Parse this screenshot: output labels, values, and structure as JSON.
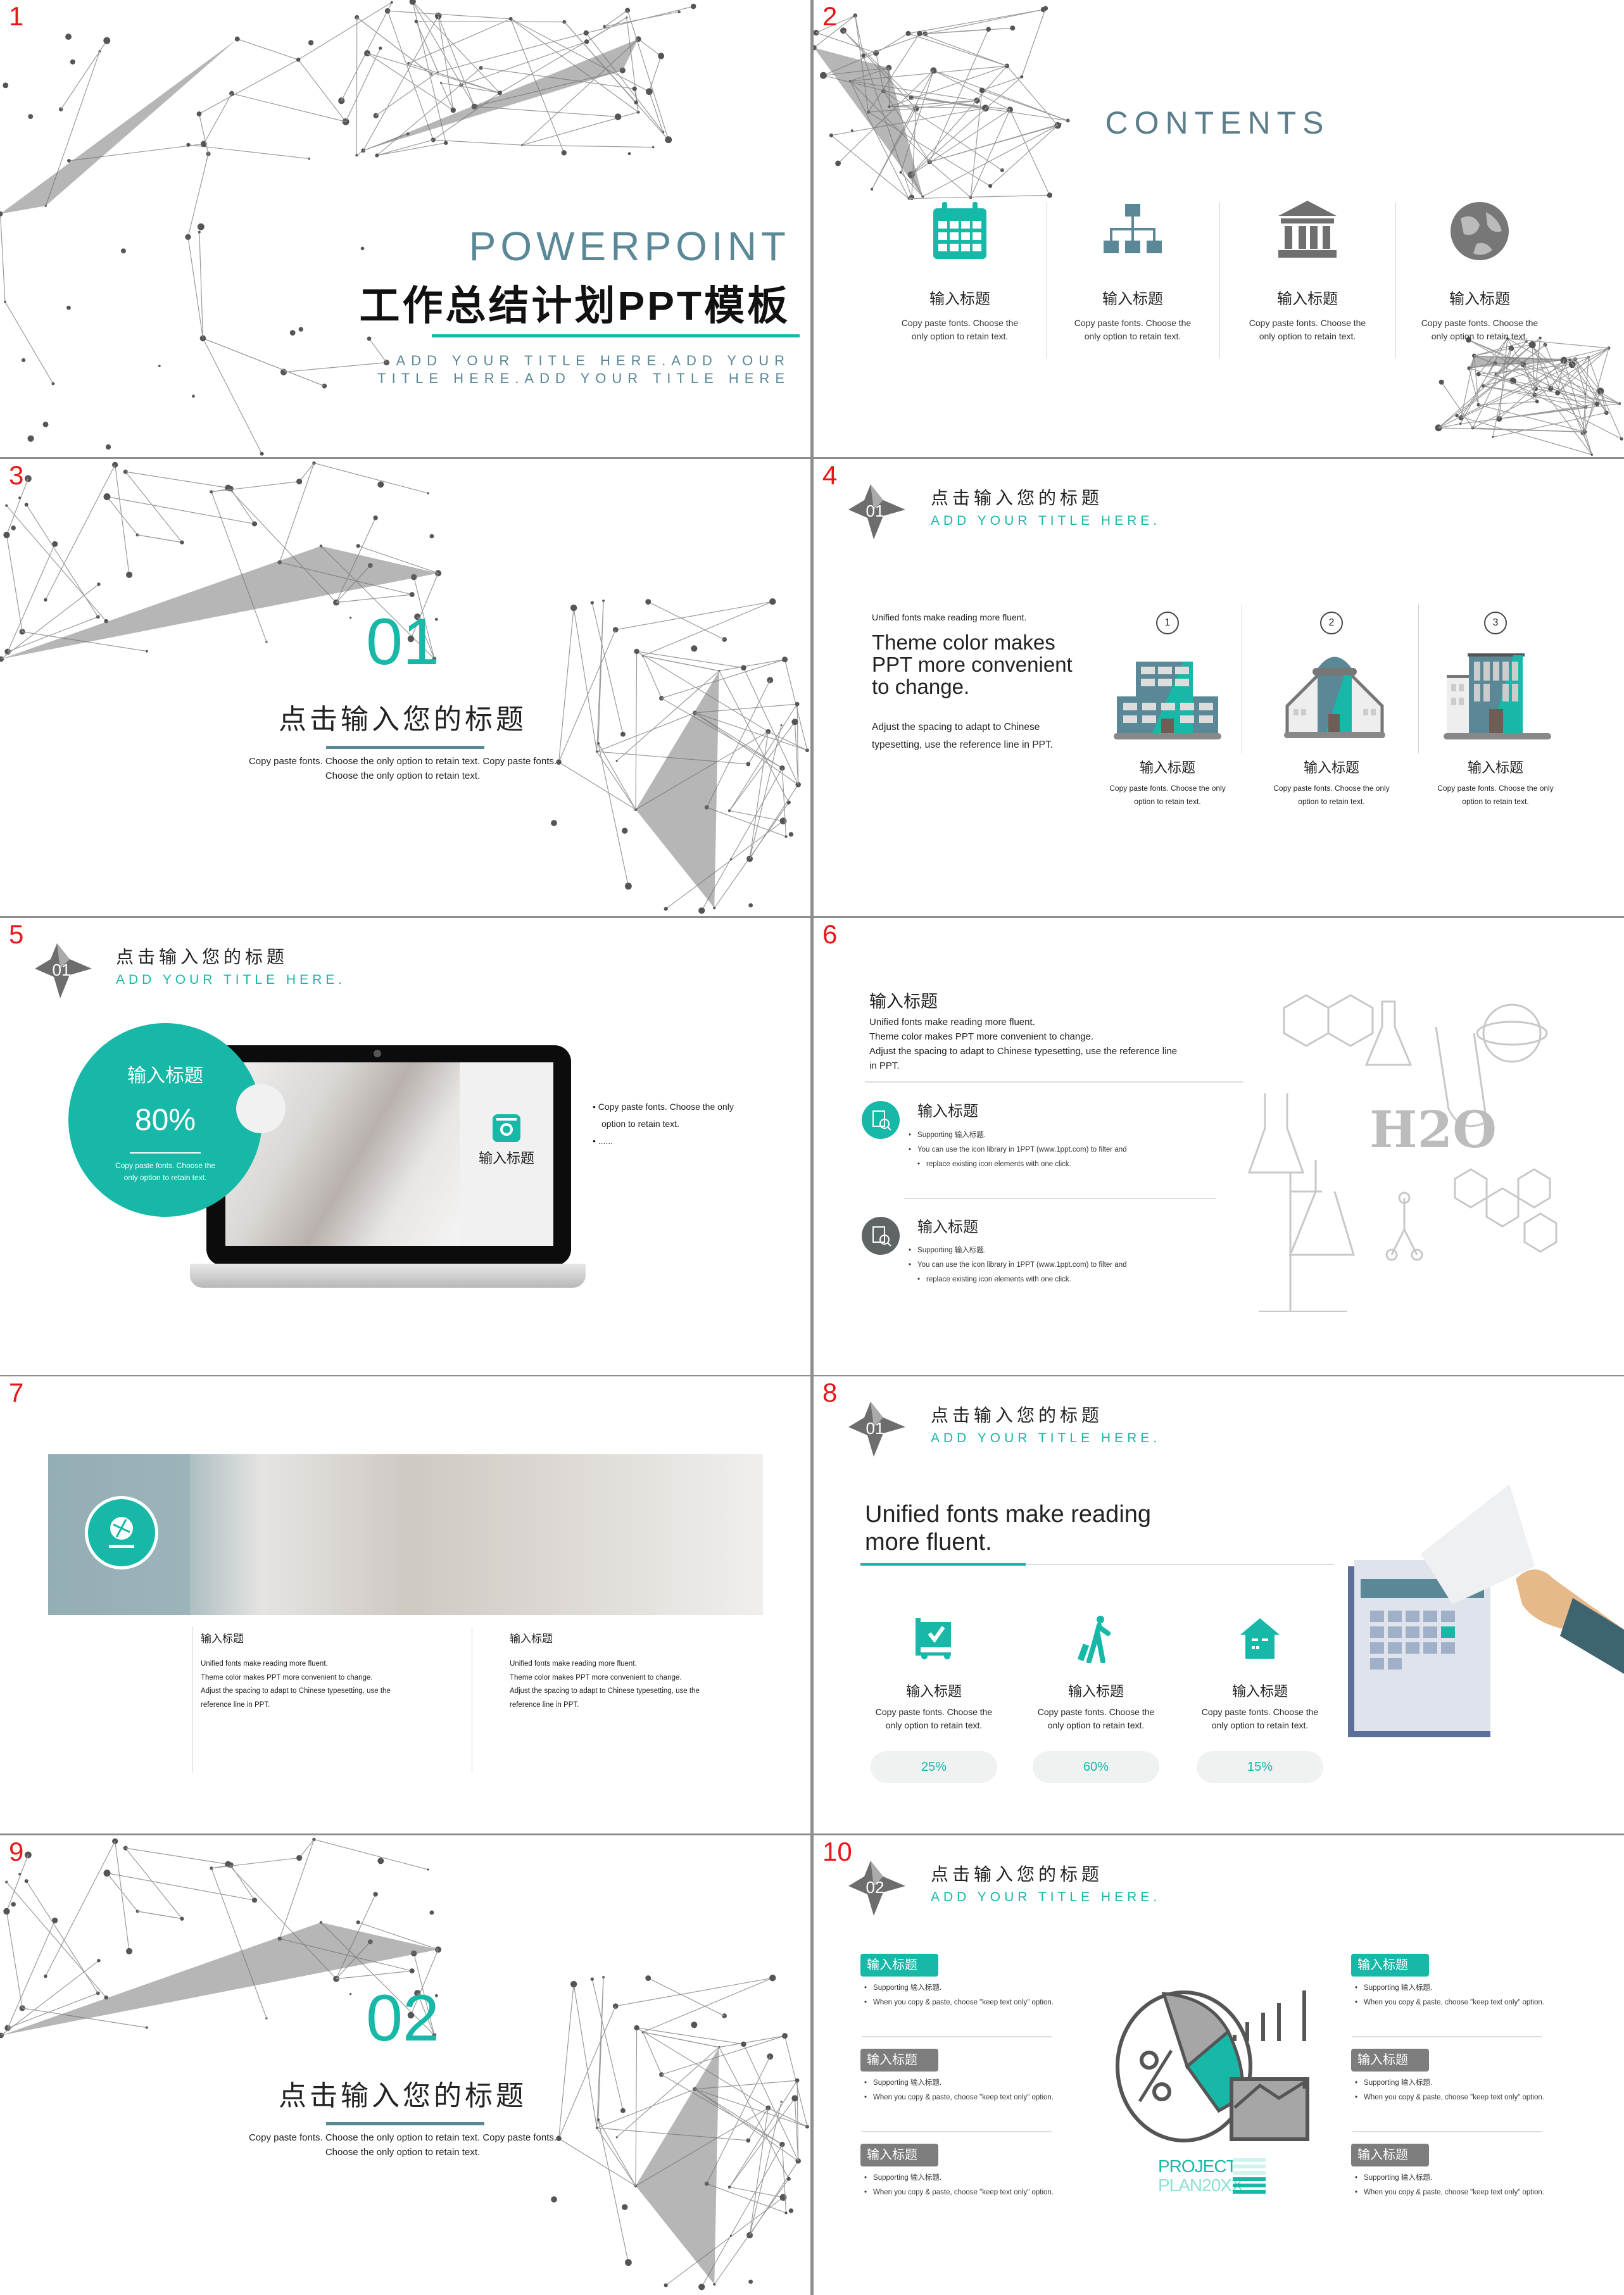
{
  "colors": {
    "accent": "#17b8a7",
    "secondary": "#5b8896",
    "gray": "#7a7a7a",
    "slide_number": "#e8161a"
  },
  "s1": {
    "number": "1",
    "brand": "POWERPOINT",
    "title": "工作总结计划PPT模板",
    "subtitle_line1": "ADD YOUR TITLE HERE.ADD YOUR",
    "subtitle_line2": "TITLE HERE.ADD YOUR TITLE HERE"
  },
  "s2": {
    "number": "2",
    "heading": "CONTENTS",
    "items": [
      {
        "icon": "calendar-icon",
        "label": "输入标题",
        "desc1": "Copy paste fonts. Choose the",
        "desc2": "only option to retain text."
      },
      {
        "icon": "org-chart-icon",
        "label": "输入标题",
        "desc1": "Copy paste fonts. Choose the",
        "desc2": "only option to retain text."
      },
      {
        "icon": "bank-icon",
        "label": "输入标题",
        "desc1": "Copy paste fonts. Choose the",
        "desc2": "only option to retain text."
      },
      {
        "icon": "globe-icon",
        "label": "输入标题",
        "desc1": "Copy paste fonts. Choose the",
        "desc2": "only option to retain text."
      }
    ]
  },
  "s3": {
    "number": "3",
    "section": "01",
    "title": "点击输入您的标题",
    "desc1": "Copy paste fonts. Choose the only option to retain text. Copy paste fonts.",
    "desc2": "Choose the only option to retain text."
  },
  "s4": {
    "number": "4",
    "badge": "01",
    "title": "点击输入您的标题",
    "subtitle": "ADD YOUR TITLE HERE.",
    "intro": "Unified fonts make reading more fluent.",
    "big1": "Theme color makes",
    "big2": "PPT more convenient",
    "big3": "to change.",
    "adjust1": "Adjust the spacing to adapt to Chinese",
    "adjust2": "typesetting, use the reference line in PPT.",
    "items": [
      {
        "step": "1",
        "label": "输入标题",
        "desc1": "Copy paste fonts. Choose the only",
        "desc2": "option to retain text."
      },
      {
        "step": "2",
        "label": "输入标题",
        "desc1": "Copy paste fonts. Choose the only",
        "desc2": "option to retain text."
      },
      {
        "step": "3",
        "label": "输入标题",
        "desc1": "Copy paste fonts. Choose the only",
        "desc2": "option to retain text."
      }
    ]
  },
  "s5": {
    "number": "5",
    "badge": "01",
    "title": "点击输入您的标题",
    "subtitle": "ADD YOUR TITLE HERE.",
    "circle_title": "输入标题",
    "percent": "80%",
    "percent_value": 80,
    "circle_desc1": "Copy paste fonts. Choose the",
    "circle_desc2": "only option to retain text.",
    "panel_label": "输入标题",
    "bullet1a": "Copy paste fonts. Choose the only",
    "bullet1b": "option to retain text.",
    "bullet2": "......"
  },
  "s6": {
    "number": "6",
    "heading": "输入标题",
    "lines": [
      "Unified fonts make reading more fluent.",
      "Theme color makes PPT more convenient to change.",
      "Adjust the spacing to adapt to Chinese typesetting, use the reference line",
      "in PPT."
    ],
    "items": [
      {
        "title": "输入标题",
        "b1": "Supporting 输入标题.",
        "b2": "You can use the icon library in 1PPT  (www.1ppt.com)   to filter and",
        "b3": "replace existing icon elements with one click."
      },
      {
        "title": "输入标题",
        "b1": "Supporting 输入标题.",
        "b2": "You can use the icon library in 1PPT  (www.1ppt.com)   to filter and",
        "b3": "replace existing icon elements with one click."
      }
    ],
    "formula": "H2O"
  },
  "s7": {
    "number": "7",
    "cols": [
      {
        "title": "输入标题",
        "l1": "Unified fonts make reading more fluent.",
        "l2": "Theme color makes PPT more convenient to change.",
        "l3": "Adjust the spacing to adapt to Chinese typesetting, use the",
        "l4": "reference line in PPT."
      },
      {
        "title": "输入标题",
        "l1": "Unified fonts make reading more fluent.",
        "l2": "Theme color makes PPT more convenient to change.",
        "l3": "Adjust the spacing to adapt to Chinese typesetting, use the",
        "l4": "reference line in PPT."
      }
    ]
  },
  "s8": {
    "number": "8",
    "badge": "01",
    "title": "点击输入您的标题",
    "subtitle": "ADD YOUR TITLE HERE.",
    "headline1": "Unified fonts make reading",
    "headline2": "more fluent.",
    "items": [
      {
        "icon": "cart-check-icon",
        "label": "输入标题",
        "desc1": "Copy paste fonts. Choose the",
        "desc2": "only option to retain text.",
        "percent": "25%"
      },
      {
        "icon": "traveler-icon",
        "label": "输入标题",
        "desc1": "Copy paste fonts. Choose the",
        "desc2": "only option to retain text.",
        "percent": "60%"
      },
      {
        "icon": "house-icon",
        "label": "输入标题",
        "desc1": "Copy paste fonts. Choose the",
        "desc2": "only option to retain text.",
        "percent": "15%"
      }
    ]
  },
  "s9": {
    "number": "9",
    "section": "02",
    "title": "点击输入您的标题",
    "desc1": "Copy paste fonts. Choose the only option to retain text. Copy paste fonts.",
    "desc2": "Choose the only option to retain text."
  },
  "s10": {
    "number": "10",
    "badge": "02",
    "title": "点击输入您的标题",
    "subtitle": "ADD YOUR TITLE HERE.",
    "logo1": "PROJECT",
    "logo2": "PLAN20XX",
    "items": [
      {
        "label": "输入标题",
        "b1": "Supporting 输入标题.",
        "b2": "When you copy & paste, choose \"keep text only\" option."
      },
      {
        "label": "输入标题",
        "b1": "Supporting 输入标题.",
        "b2": "When you copy & paste, choose \"keep text only\" option."
      },
      {
        "label": "输入标题",
        "b1": "Supporting 输入标题.",
        "b2": "When you copy & paste, choose \"keep text only\" option."
      },
      {
        "label": "输入标题",
        "b1": "Supporting 输入标题.",
        "b2": "When you copy & paste, choose \"keep text only\" option."
      },
      {
        "label": "输入标题",
        "b1": "Supporting 输入标题.",
        "b2": "When you copy & paste, choose \"keep text only\" option."
      },
      {
        "label": "输入标题",
        "b1": "Supporting 输入标题.",
        "b2": "When you copy & paste, choose \"keep text only\" option."
      }
    ]
  }
}
